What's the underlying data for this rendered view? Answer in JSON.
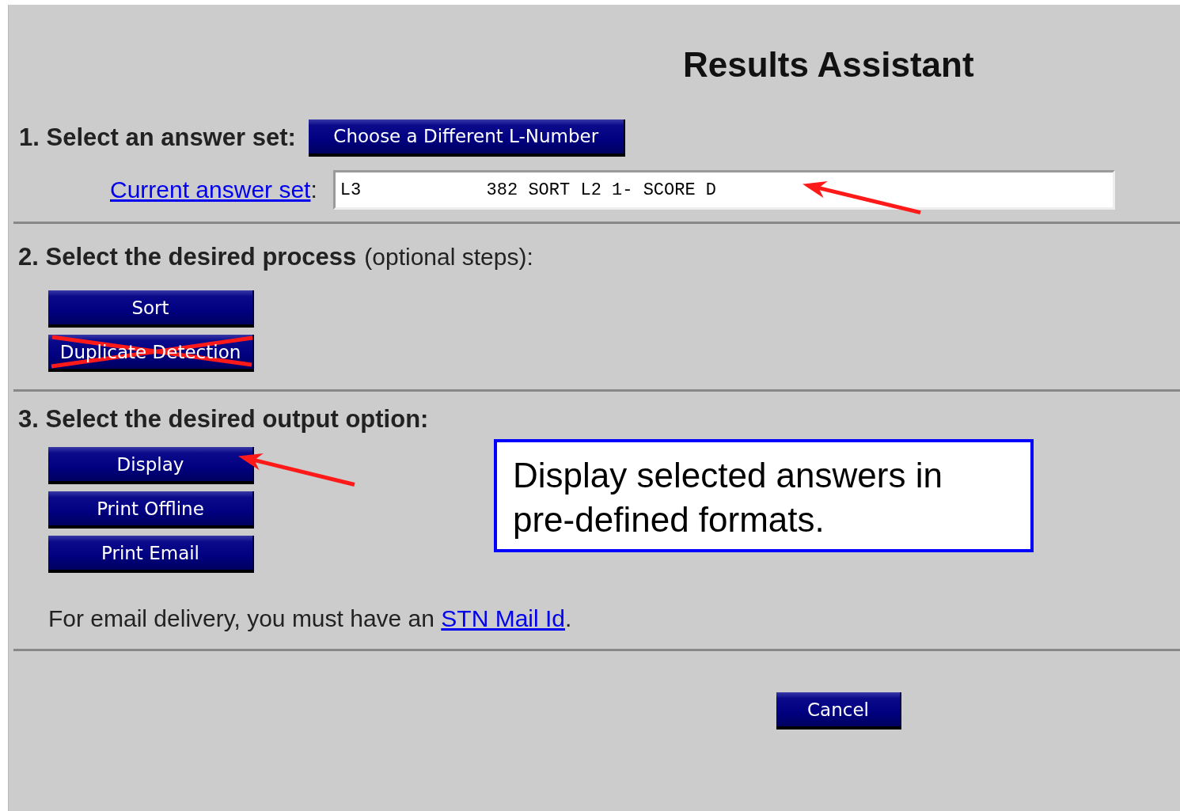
{
  "title": "Results Assistant",
  "step1": {
    "label": "1. Select an answer set:",
    "button": "Choose a Different L-Number",
    "link": "Current answer set",
    "link_suffix": ":",
    "field_value": "L3            382 SORT L2 1- SCORE D",
    "pointed": true
  },
  "step2": {
    "label": "2. Select the desired process",
    "hint": "(optional steps):",
    "buttons": [
      {
        "label": "Sort",
        "crossed_out": false
      },
      {
        "label": "Duplicate Detection",
        "crossed_out": true
      }
    ]
  },
  "step3": {
    "label": "3. Select the desired output option:",
    "buttons": [
      {
        "label": "Display",
        "pointed": true
      },
      {
        "label": "Print Offline",
        "pointed": false
      },
      {
        "label": "Print Email",
        "pointed": false
      }
    ],
    "note_before": "For email delivery, you must have an",
    "note_link": "STN Mail Id",
    "note_after": "."
  },
  "callout": "Display selected answers in pre-defined formats.",
  "cancel": "Cancel"
}
